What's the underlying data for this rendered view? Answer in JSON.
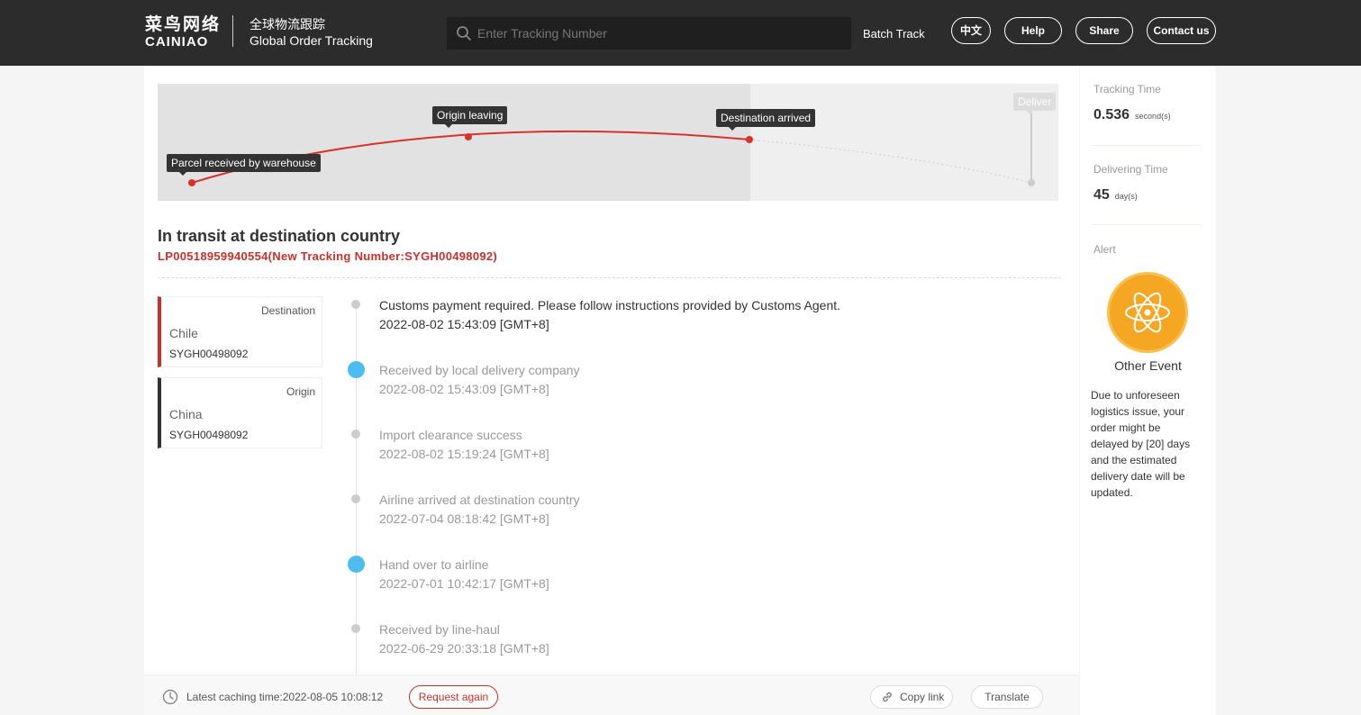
{
  "header": {
    "logo_cn": "菜鸟网络",
    "logo_en": "CAINIAO",
    "subtitle_cn": "全球物流跟踪",
    "subtitle_en": "Global Order Tracking",
    "search_placeholder": "Enter Tracking Number",
    "batch_track": "Batch Track",
    "buttons": {
      "lang": "中文",
      "help": "Help",
      "share": "Share",
      "contact": "Contact us"
    }
  },
  "map": {
    "pins": {
      "received": "Parcel received by warehouse",
      "origin": "Origin leaving",
      "destination": "Destination arrived",
      "deliver": "Deliver"
    }
  },
  "status": {
    "title": "In transit at destination country",
    "tracking": "LP00518959940554(New Tracking Number:SYGH00498092)"
  },
  "cards": [
    {
      "label": "Destination",
      "country": "Chile",
      "number": "SYGH00498092"
    },
    {
      "label": "Origin",
      "country": "China",
      "number": "SYGH00498092"
    }
  ],
  "timeline": [
    {
      "event": "Customs payment required. Please follow instructions provided by Customs Agent.",
      "time": "2022-08-02 15:43:09 [GMT+8]"
    },
    {
      "event": "Received by local delivery company",
      "time": "2022-08-02 15:43:09 [GMT+8]"
    },
    {
      "event": "Import clearance success",
      "time": "2022-08-02 15:19:24 [GMT+8]"
    },
    {
      "event": "Airline arrived at destination country",
      "time": "2022-07-04 08:18:42 [GMT+8]"
    },
    {
      "event": "Hand over to airline",
      "time": "2022-07-01 10:42:17 [GMT+8]"
    },
    {
      "event": "Received by line-haul",
      "time": "2022-06-29 20:33:18 [GMT+8]"
    }
  ],
  "side": {
    "tracking_time_label": "Tracking Time",
    "tracking_time_value": "0.536",
    "tracking_time_unit": "second(s)",
    "delivering_time_label": "Delivering Time",
    "delivering_time_value": "45",
    "delivering_time_unit": "day(s)",
    "alert_label": "Alert",
    "alert_title": "Other Event",
    "alert_text": "Due to unforeseen logistics issue, your order might be delayed by [20] days and the estimated delivery date will be updated."
  },
  "bottom": {
    "cache": "Latest caching time:2022-08-05 10:08:12",
    "request_again": "Request again",
    "copy_link": "Copy link",
    "translate": "Translate"
  },
  "colors": {
    "header_bg": "#2c2c2c",
    "accent_red": "#c8312a",
    "timeline_blue": "#4dbcf0",
    "alert_orange": "#f5a623"
  }
}
